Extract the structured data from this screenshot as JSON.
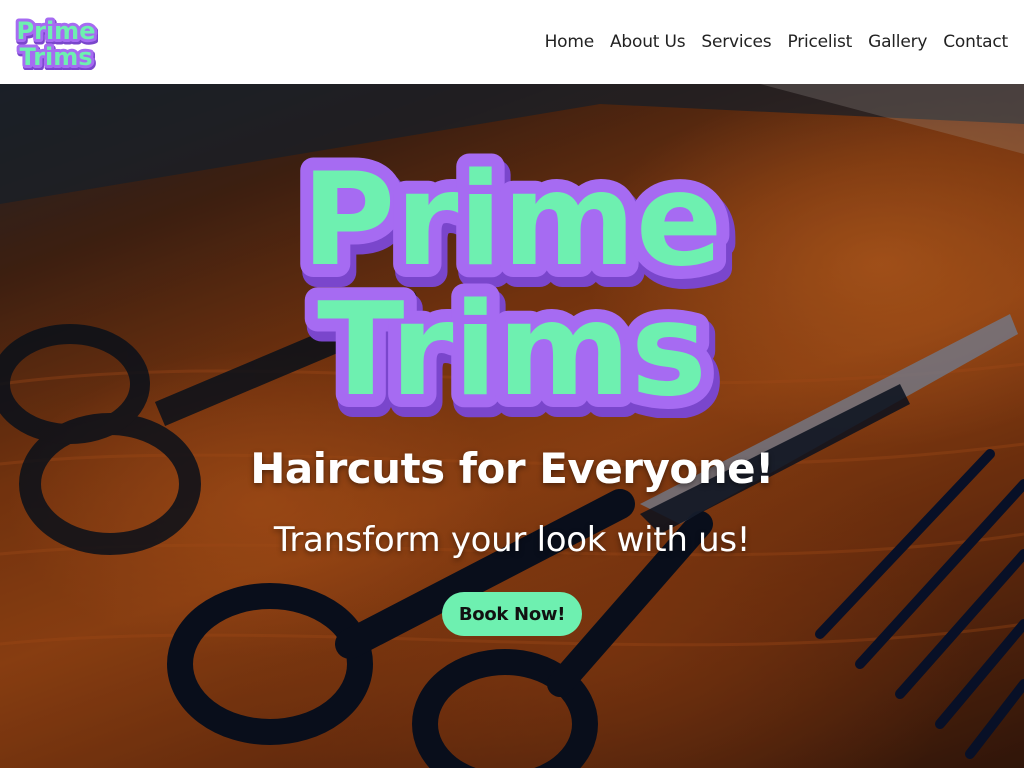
{
  "brand": {
    "name": "Prime Trims",
    "line1": "Prime",
    "line2": "Trims",
    "fill_color": "#6ef0b0",
    "outline_color": "#a66bf2",
    "shadow_color": "#7a46cc"
  },
  "nav": {
    "items": [
      {
        "label": "Home"
      },
      {
        "label": "About Us"
      },
      {
        "label": "Services"
      },
      {
        "label": "Pricelist"
      },
      {
        "label": "Gallery"
      },
      {
        "label": "Contact"
      }
    ]
  },
  "hero": {
    "title": "Haircuts for Everyone!",
    "subtitle": "Transform your look with us!",
    "cta_label": "Book Now!",
    "cta_color": "#6ef0b0"
  }
}
